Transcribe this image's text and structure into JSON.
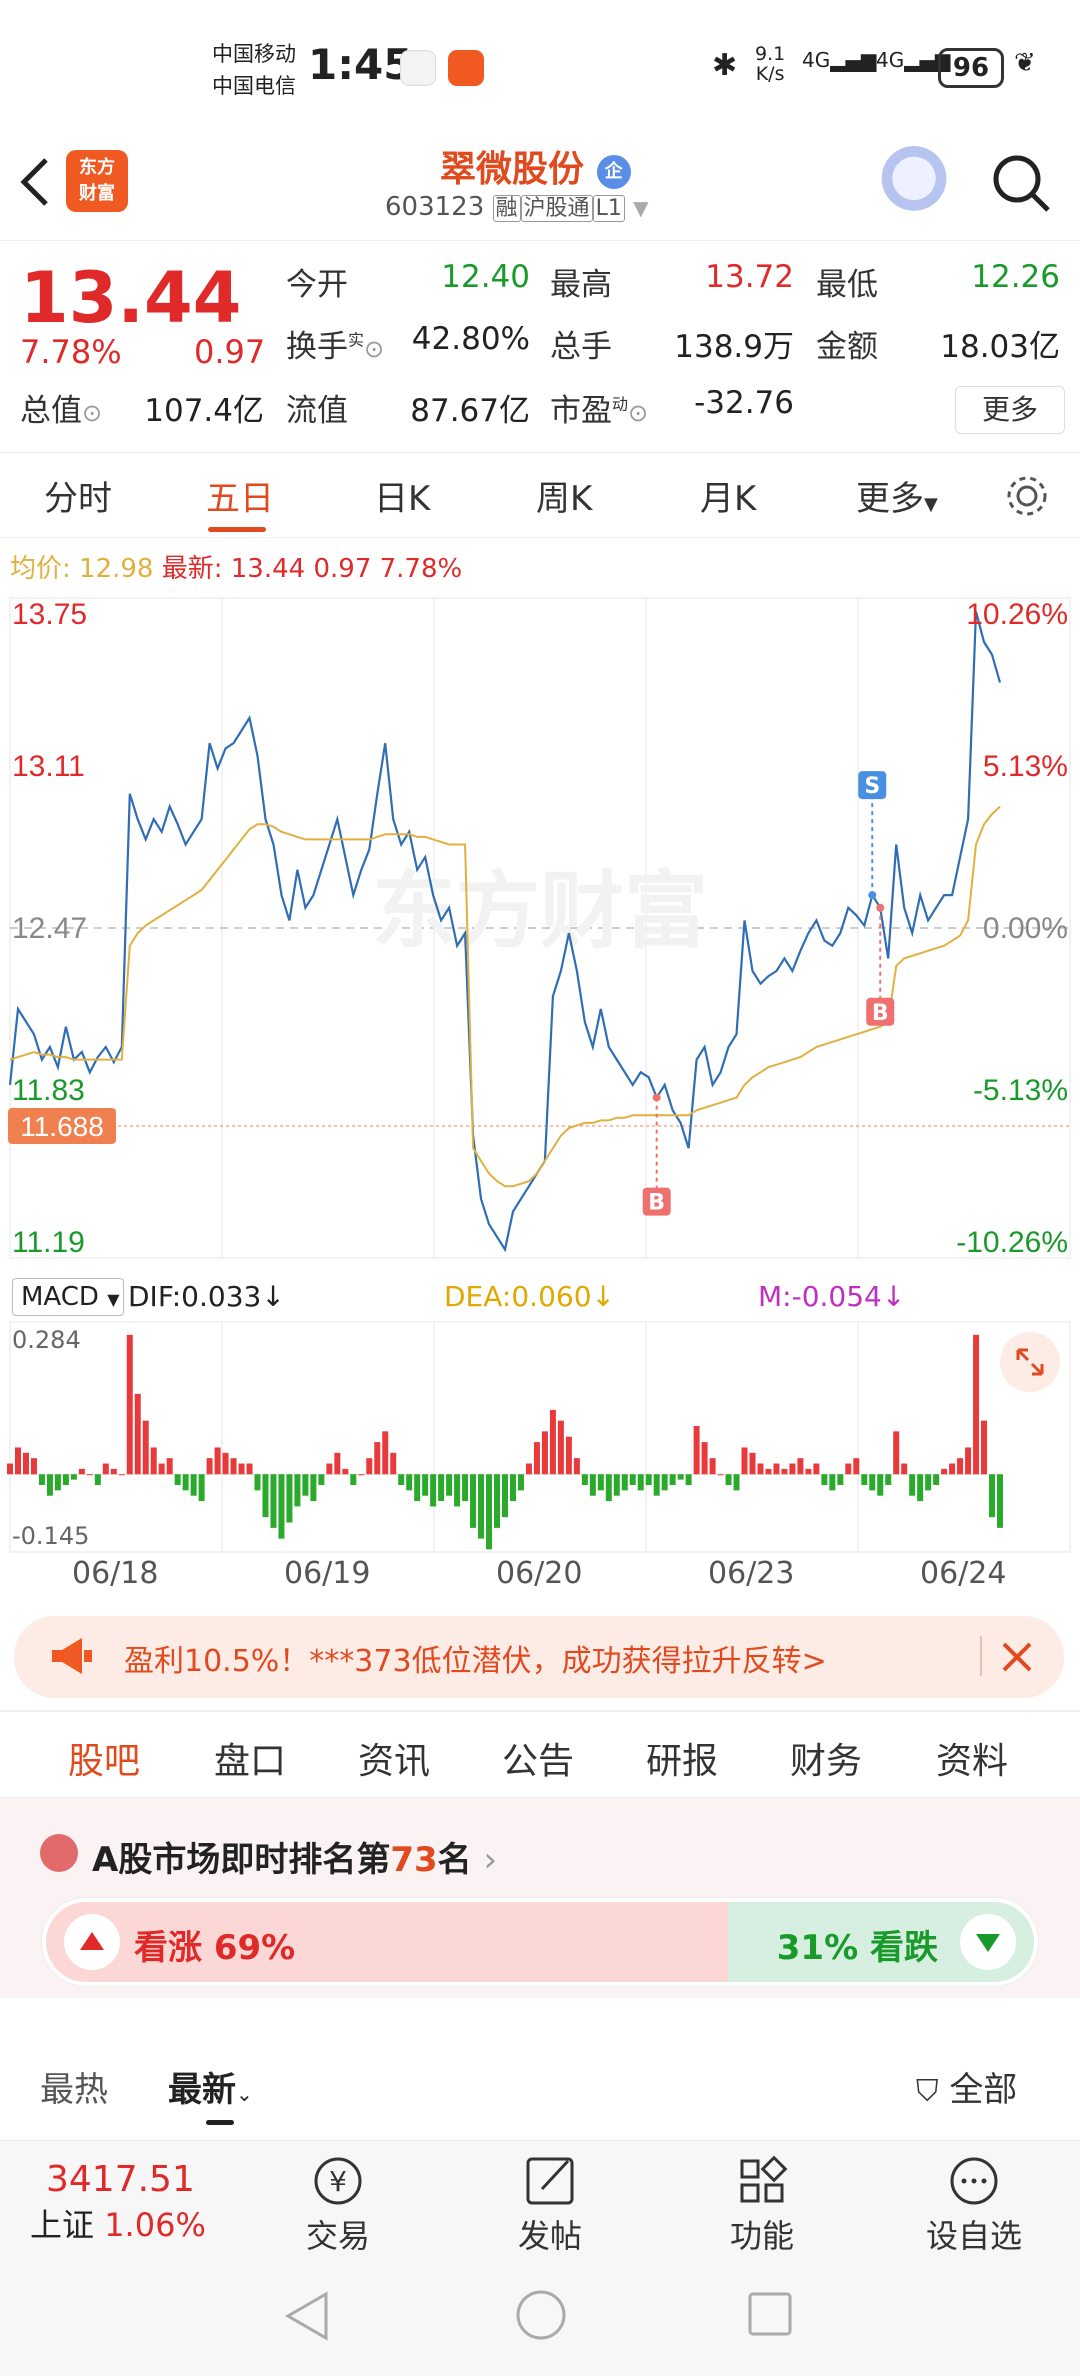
{
  "status": {
    "carrier1": "中国移动",
    "carrier2": "中国电信",
    "time": "1:45",
    "net_speed": "9.1",
    "net_unit": "K/s",
    "sig1": "4G",
    "sig2": "4G",
    "battery": "96"
  },
  "header": {
    "logo_line1": "东方",
    "logo_line2": "财富",
    "stock_name": "翠微股份",
    "stock_badge": "企",
    "stock_code": "603123",
    "tags": [
      "融",
      "沪股通",
      "L1"
    ]
  },
  "quote": {
    "price": "13.44",
    "change_pct": "7.78%",
    "change": "0.97",
    "rows": [
      [
        {
          "label": "今开",
          "value": "12.40",
          "color": "green"
        },
        {
          "label": "最高",
          "value": "13.72",
          "color": "red"
        },
        {
          "label": "最低",
          "value": "12.26",
          "color": "green"
        }
      ],
      [
        {
          "label": "换手",
          "value": "42.80%",
          "color": "dark"
        },
        {
          "label": "总手",
          "value": "138.9万",
          "color": "dark"
        },
        {
          "label": "金额",
          "value": "18.03亿",
          "color": "dark"
        }
      ],
      [
        {
          "label": "总值",
          "value": "107.4亿",
          "color": "dark"
        },
        {
          "label": "流值",
          "value": "87.67亿",
          "color": "dark"
        },
        {
          "label": "市盈",
          "value": "-32.76",
          "color": "dark"
        }
      ]
    ],
    "turnover_sup": "实",
    "pe_sup": "动",
    "more_label": "更多"
  },
  "chart_tabs": [
    "分时",
    "五日",
    "日K",
    "周K",
    "月K",
    "更多"
  ],
  "active_chart_tab": 1,
  "avg_line": {
    "avg_label": "均价:",
    "avg_value": "12.98",
    "latest_label": "最新:",
    "latest_value": "13.44",
    "latest_change": "0.97",
    "latest_pct": "7.78%"
  },
  "watermark": "东方财富",
  "chart_data": [
    {
      "type": "line",
      "title": "五日分时",
      "y_ticks_left": [
        "13.75",
        "13.11",
        "12.47",
        "11.83",
        "11.19"
      ],
      "y_ticks_right": [
        "10.26%",
        "5.13%",
        "0.00%",
        "-5.13%",
        "-10.26%"
      ],
      "ylim": [
        11.19,
        13.75
      ],
      "prev_close": 12.47,
      "price_marker": "11.688",
      "x_labels": [
        "06/18",
        "06/19",
        "06/20",
        "06/23",
        "06/24"
      ],
      "series": [
        {
          "name": "价格",
          "color": "#2f6db5",
          "values": [
            11.85,
            12.15,
            12.1,
            12.05,
            11.95,
            12.0,
            11.92,
            12.08,
            11.95,
            11.98,
            11.9,
            11.96,
            12.0,
            11.94,
            12.0,
            13.0,
            12.9,
            12.82,
            12.9,
            12.85,
            12.95,
            12.88,
            12.8,
            12.85,
            12.9,
            13.2,
            13.1,
            13.18,
            13.2,
            13.25,
            13.3,
            13.15,
            12.9,
            12.8,
            12.6,
            12.5,
            12.7,
            12.55,
            12.6,
            12.7,
            12.8,
            12.9,
            12.75,
            12.6,
            12.7,
            12.78,
            13.0,
            13.2,
            12.9,
            12.8,
            12.85,
            12.7,
            12.75,
            12.6,
            12.5,
            12.55,
            12.4,
            12.45,
            11.65,
            11.4,
            11.3,
            11.25,
            11.2,
            11.35,
            11.4,
            11.45,
            11.5,
            11.55,
            12.2,
            12.3,
            12.45,
            12.3,
            12.1,
            12.0,
            12.15,
            12.0,
            11.95,
            11.9,
            11.85,
            11.9,
            11.88,
            11.8,
            11.85,
            11.75,
            11.7,
            11.6,
            11.95,
            12.0,
            11.85,
            11.9,
            12.0,
            12.05,
            12.5,
            12.3,
            12.25,
            12.28,
            12.3,
            12.35,
            12.3,
            12.38,
            12.45,
            12.5,
            12.42,
            12.4,
            12.45,
            12.55,
            12.52,
            12.48,
            12.6,
            12.55,
            12.35,
            12.8,
            12.55,
            12.45,
            12.6,
            12.5,
            12.55,
            12.6,
            12.6,
            12.75,
            12.9,
            13.72,
            13.6,
            13.55,
            13.44
          ]
        },
        {
          "name": "均价",
          "color": "#e0b040",
          "values": [
            11.95,
            11.96,
            11.97,
            11.98,
            11.97,
            11.97,
            11.96,
            11.96,
            11.95,
            11.95,
            11.95,
            11.95,
            11.95,
            11.95,
            11.95,
            12.4,
            12.45,
            12.48,
            12.5,
            12.52,
            12.54,
            12.56,
            12.58,
            12.6,
            12.62,
            12.66,
            12.7,
            12.74,
            12.78,
            12.82,
            12.86,
            12.88,
            12.88,
            12.87,
            12.85,
            12.84,
            12.83,
            12.82,
            12.82,
            12.82,
            12.82,
            12.82,
            12.82,
            12.82,
            12.82,
            12.82,
            12.83,
            12.84,
            12.84,
            12.84,
            12.84,
            12.83,
            12.83,
            12.82,
            12.81,
            12.8,
            12.8,
            12.8,
            11.6,
            11.55,
            11.5,
            11.47,
            11.45,
            11.45,
            11.46,
            11.47,
            11.5,
            11.55,
            11.6,
            11.65,
            11.68,
            11.69,
            11.7,
            11.7,
            11.71,
            11.71,
            11.72,
            11.72,
            11.73,
            11.73,
            11.73,
            11.73,
            11.73,
            11.73,
            11.73,
            11.73,
            11.75,
            11.76,
            11.77,
            11.78,
            11.79,
            11.8,
            11.85,
            11.88,
            11.9,
            11.92,
            11.93,
            11.94,
            11.95,
            11.96,
            11.98,
            12.0,
            12.01,
            12.02,
            12.03,
            12.04,
            12.05,
            12.06,
            12.07,
            12.08,
            12.1,
            12.32,
            12.35,
            12.36,
            12.37,
            12.38,
            12.39,
            12.4,
            12.42,
            12.44,
            12.5,
            12.8,
            12.88,
            12.92,
            12.95
          ]
        }
      ],
      "trade_markers": [
        {
          "label": "S",
          "kind": "sell",
          "x_index": 108
        },
        {
          "label": "B",
          "kind": "buy",
          "x_index": 109
        },
        {
          "label": "B",
          "kind": "buy",
          "x_index": 81
        }
      ]
    },
    {
      "type": "bar",
      "title": "MACD",
      "indicator_label": "MACD",
      "dif_label": "DIF:0.033↓",
      "dea_label": "DEA:0.060↓",
      "m_label": "M:-0.054↓",
      "y_ticks": [
        "0.284",
        "-0.145"
      ],
      "ylim": [
        -0.145,
        0.284
      ],
      "histogram": [
        0.02,
        0.05,
        0.04,
        0.03,
        -0.02,
        -0.04,
        -0.03,
        -0.02,
        -0.01,
        0.01,
        0.0,
        -0.02,
        0.02,
        0.01,
        0.0,
        0.26,
        0.15,
        0.1,
        0.05,
        0.02,
        0.03,
        -0.02,
        -0.03,
        -0.04,
        -0.05,
        0.03,
        0.05,
        0.04,
        0.03,
        0.02,
        0.02,
        -0.03,
        -0.08,
        -0.1,
        -0.12,
        -0.09,
        -0.06,
        -0.04,
        -0.05,
        -0.02,
        0.02,
        0.04,
        0.01,
        -0.02,
        0.0,
        0.03,
        0.06,
        0.08,
        0.04,
        -0.02,
        -0.03,
        -0.05,
        -0.04,
        -0.06,
        -0.05,
        -0.04,
        -0.06,
        -0.05,
        -0.1,
        -0.12,
        -0.14,
        -0.1,
        -0.08,
        -0.05,
        -0.03,
        0.02,
        0.06,
        0.08,
        0.12,
        0.1,
        0.07,
        0.03,
        -0.02,
        -0.04,
        -0.03,
        -0.05,
        -0.04,
        -0.03,
        -0.02,
        -0.03,
        -0.02,
        -0.04,
        -0.03,
        -0.02,
        -0.01,
        -0.02,
        0.09,
        0.06,
        0.03,
        0.0,
        -0.02,
        -0.03,
        0.05,
        0.04,
        0.02,
        0.01,
        0.02,
        0.01,
        0.02,
        0.03,
        0.01,
        0.02,
        -0.02,
        -0.03,
        -0.02,
        0.02,
        0.03,
        -0.02,
        -0.03,
        -0.04,
        -0.02,
        0.08,
        0.02,
        -0.04,
        -0.05,
        -0.03,
        -0.02,
        0.01,
        0.02,
        0.03,
        0.05,
        0.26,
        0.1,
        -0.08,
        -0.1
      ]
    }
  ],
  "promo": {
    "text": "盈利10.5%！***373低位潜伏，成功获得拉升反转>"
  },
  "sub_tabs": [
    "股吧",
    "盘口",
    "资讯",
    "公告",
    "研报",
    "财务",
    "资料"
  ],
  "active_sub_tab": 0,
  "rank": {
    "prefix": "A股市场即时排名第",
    "rank": "73",
    "suffix": "名"
  },
  "sentiment": {
    "up_label": "看涨 69%",
    "down_label": "31% 看跌",
    "up_share": 0.69
  },
  "feed_tabs": {
    "hot": "最热",
    "latest": "最新",
    "filter": "全部"
  },
  "bottom_nav": {
    "index_value": "3417.51",
    "index_name": "上证",
    "index_pct": "1.06%",
    "items": [
      "交易",
      "发帖",
      "功能",
      "设自选"
    ]
  }
}
